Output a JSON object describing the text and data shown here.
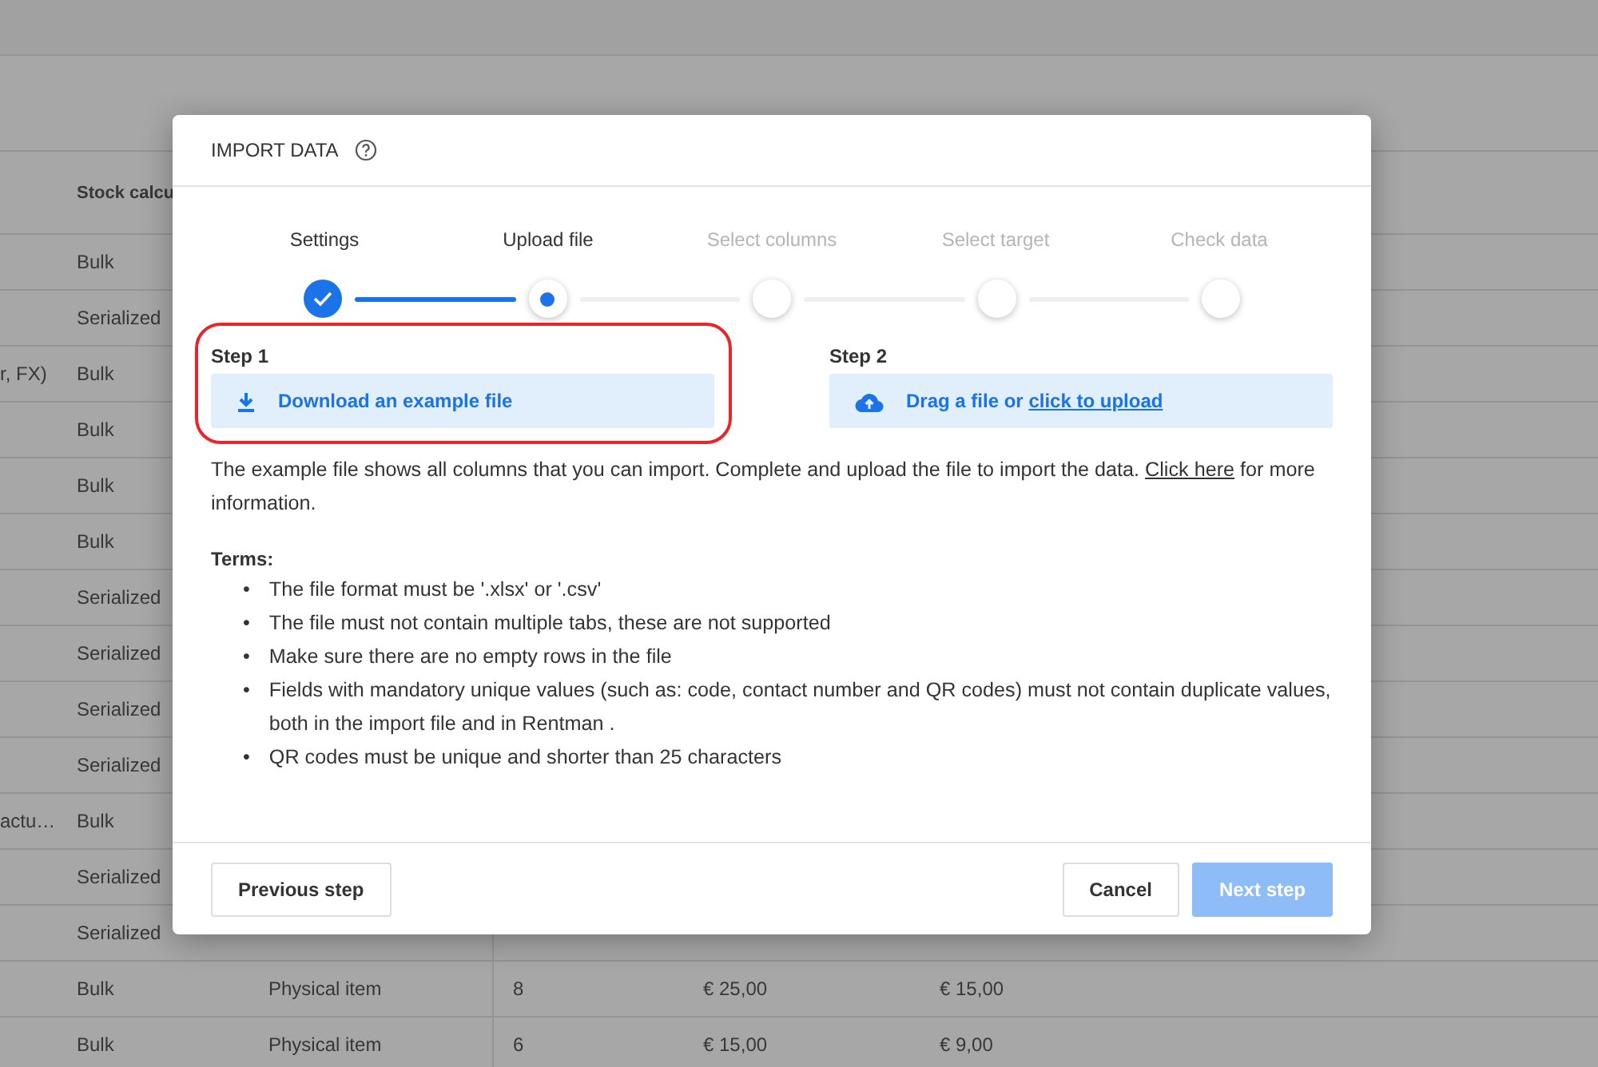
{
  "background_table": {
    "columns": [
      "",
      "Stock calcu"
    ],
    "rows": [
      {
        "cells": [
          "",
          "Bulk"
        ]
      },
      {
        "cells": [
          "",
          "Serialized"
        ]
      },
      {
        "cells": [
          "r, FX)",
          "Bulk"
        ]
      },
      {
        "cells": [
          "",
          "Bulk"
        ]
      },
      {
        "cells": [
          "",
          "Bulk"
        ]
      },
      {
        "cells": [
          "",
          "Bulk"
        ]
      },
      {
        "cells": [
          "",
          "Serialized"
        ]
      },
      {
        "cells": [
          "",
          "Serialized"
        ]
      },
      {
        "cells": [
          "",
          "Serialized"
        ]
      },
      {
        "cells": [
          "",
          "Serialized"
        ]
      },
      {
        "cells": [
          "actu…",
          "Bulk"
        ]
      },
      {
        "cells": [
          "",
          "Serialized"
        ]
      },
      {
        "cells": [
          "",
          "Serialized"
        ]
      },
      {
        "cells": [
          "",
          "Bulk",
          "Physical item",
          "8",
          "€ 25,00",
          "€ 15,00"
        ]
      },
      {
        "cells": [
          "",
          "Bulk",
          "Physical item",
          "6",
          "€ 15,00",
          "€ 9,00"
        ]
      }
    ]
  },
  "dialog": {
    "title": "IMPORT DATA",
    "steps": [
      {
        "label": "Settings",
        "done": true,
        "selected": false
      },
      {
        "label": "Upload file",
        "done": false,
        "selected": true
      },
      {
        "label": "Select columns",
        "done": false,
        "selected": false
      },
      {
        "label": "Select target",
        "done": false,
        "selected": false
      },
      {
        "label": "Check data",
        "done": false,
        "selected": false
      }
    ],
    "actions": [
      {
        "kind": "download",
        "heading": "Step 1",
        "text": "Download an example file",
        "highlighted": true
      },
      {
        "kind": "upload",
        "heading": "Step 2",
        "text": "Drag a file or ",
        "link": "click to upload"
      }
    ],
    "description": {
      "text": "The example file shows all columns that you can import. Complete and upload the file to import the data. ",
      "link": "Click here",
      "after": " for more information."
    },
    "terms_title": "Terms:",
    "terms": [
      {
        "bullet": "•",
        "text": "The file format must be '.xlsx' or '.csv'"
      },
      {
        "bullet": "•",
        "text": "The file must not contain multiple tabs, these are not supported"
      },
      {
        "bullet": "•",
        "text": "Make sure there are no empty rows in the file"
      },
      {
        "bullet": "•",
        "text": "Fields with mandatory unique values (such as: code, contact number and QR codes) must not contain duplicate values, both in the import file and in Rentman ."
      },
      {
        "bullet": "•",
        "text": "QR codes must be unique and shorter than 25 characters"
      }
    ],
    "buttons": [
      {
        "label": "Previous step",
        "kind": "secondary"
      },
      {
        "label": "Cancel",
        "kind": "secondary"
      },
      {
        "label": "Next step",
        "kind": "primary",
        "disabled": true
      }
    ]
  }
}
